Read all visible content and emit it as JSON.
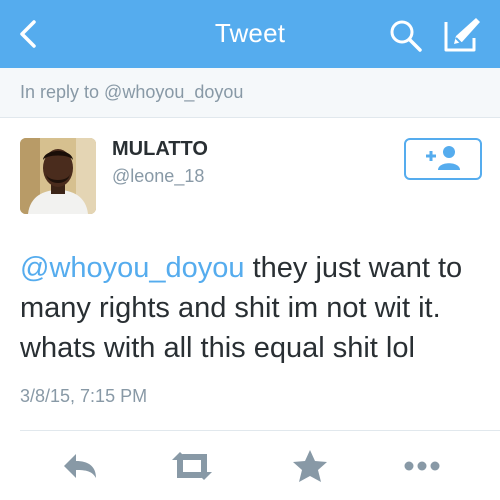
{
  "navbar": {
    "title": "Tweet",
    "back_icon": "chevron-left-icon",
    "search_icon": "search-icon",
    "compose_icon": "compose-icon",
    "background": "#55acee"
  },
  "reply": {
    "text": "In reply to @whoyou_doyou"
  },
  "author": {
    "name": "MULATTO",
    "handle": "@leone_18",
    "follow_icon": "add-user-icon"
  },
  "tweet": {
    "mention": "@whoyou_doyou",
    "text": " they just want to many rights and shit im not wit it. whats with all this equal shit lol",
    "timestamp": "3/8/15, 7:15 PM"
  },
  "actions": [
    {
      "name": "reply-icon"
    },
    {
      "name": "retweet-icon"
    },
    {
      "name": "favorite-icon"
    },
    {
      "name": "more-icon"
    }
  ],
  "colors": {
    "accent": "#55acee",
    "muted_text": "#8899a6",
    "action_icon": "#8899a6"
  }
}
